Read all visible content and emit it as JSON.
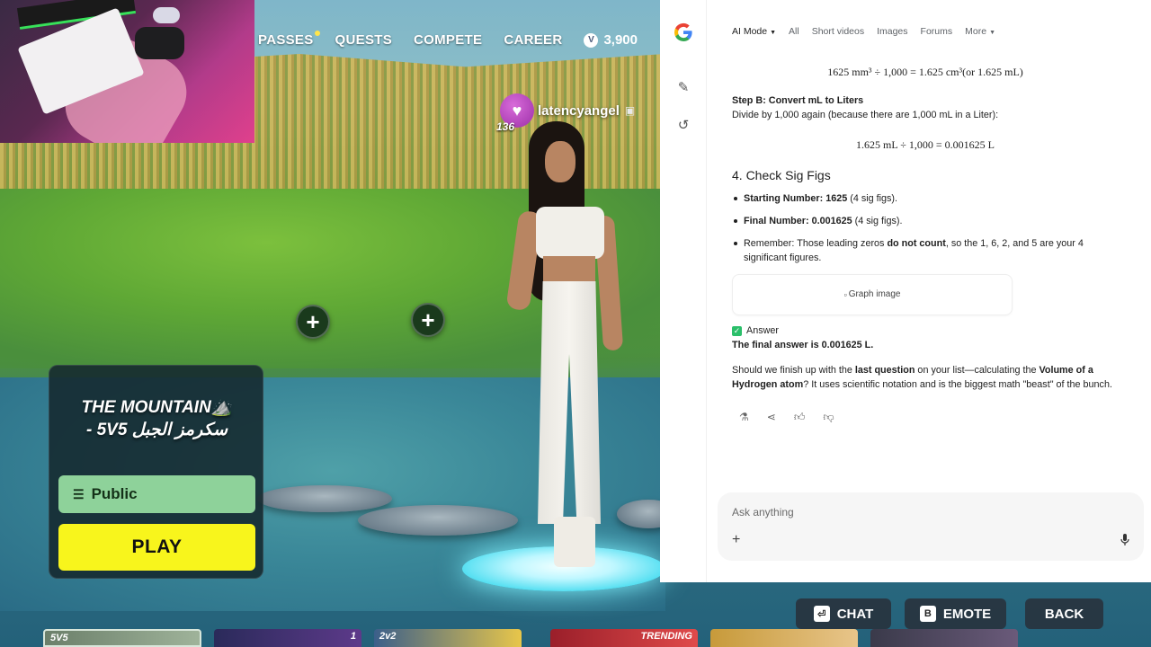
{
  "game": {
    "nav": [
      "PASSES",
      "QUESTS",
      "COMPETE",
      "CAREER"
    ],
    "vbucks": "3,900",
    "player": {
      "name": "latencyangel",
      "level": "136"
    },
    "mode": {
      "title_line1": "THE MOUNTAIN⛰️",
      "title_line2": "- 5V5 سكرمز الجبل",
      "privacy": "Public",
      "play": "PLAY"
    },
    "buttons": {
      "chat": {
        "key": "⏎",
        "label": "CHAT"
      },
      "emote": {
        "key": "B",
        "label": "EMOTE"
      },
      "back": {
        "label": "BACK"
      }
    },
    "thumbnails": [
      "5V5",
      "1",
      "2v2",
      "TRENDING"
    ]
  },
  "browser": {
    "tabs": [
      "AI Mode",
      "All",
      "Short videos",
      "Images",
      "Forums",
      "More"
    ],
    "math_top": "1625 mm³ ÷ 1,000 = 1.625 cm³(or 1.625 mL)",
    "step_b_title": "Step B: Convert mL to Liters",
    "step_b_text": "Divide by 1,000 again (because there are 1,000 mL in a Liter):",
    "math_mid": "1.625 mL ÷ 1,000 = 0.001625 L",
    "section_title": "4. Check Sig Figs",
    "bullets": [
      {
        "label": "Starting Number:",
        "value": "1625",
        "note": "(4 sig figs)."
      },
      {
        "label": "Final Number:",
        "value": "0.001625",
        "note": "(4 sig figs)."
      },
      {
        "label": "Remember:",
        "pre": "Those leading zeros ",
        "bold": "do not count",
        "post": ", so the 1, 6, 2, and 5 are your 4 significant figures."
      }
    ],
    "graph_alt": "Graph image",
    "answer_label": "Answer",
    "answer_text": "The final answer is 0.001625 L.",
    "followup_1": "Should we finish up with the ",
    "followup_b1": "last question",
    "followup_2": " on your list—calculating the ",
    "followup_b2": "Volume of a Hydrogen atom",
    "followup_3": "? It uses scientific notation and is the biggest math \"beast\" of the bunch.",
    "ask_placeholder": "Ask anything"
  }
}
